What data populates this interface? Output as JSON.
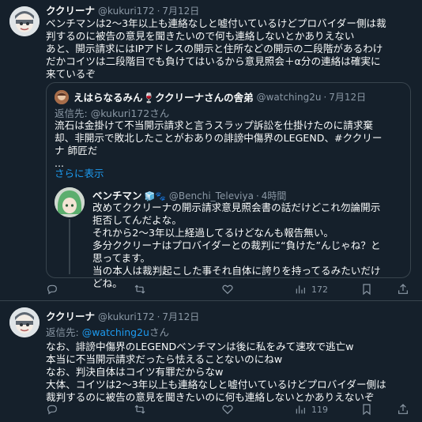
{
  "tweet1": {
    "name": "ククリーナ",
    "handle": "@kukuri172",
    "dot": "·",
    "time": "7月12日",
    "lines": [
      "ベンチマンは2～3年以上も連絡なしと嘘付いているけどプロバイダー側は裁",
      "判するのに被告の意見を聞きたいので何も連絡しないとかありえない",
      "あと、開示請求にはIPアドレスの開示と住所などの開示の二段階があるわけ",
      "だかコイツは二段階目でも負けてはいるから意見照会＋α分の連絡は確実に",
      "来ているぞ"
    ],
    "quote": {
      "name": "えはらなるみん🍷ククリーナさんの舎弟",
      "handle": "@watching2u",
      "dot": "·",
      "time": "7月12日",
      "reply_prefix": "返信先: ",
      "reply_handle": "@kukuri172",
      "reply_suffix": "さん",
      "lines": [
        "流石は金掛けて不当開示請求と言うスラップ訴訟を仕掛けたのに請求棄",
        "却、非開示で敗北したことがおありの誹謗中傷界のLEGEND、#ククリー",
        "ナ 師匠だ",
        "..."
      ],
      "show_more": "さらに表示"
    },
    "reply": {
      "name": "ベンチマン",
      "badges": "🧊🐾",
      "handle": "@Benchi_Televiya",
      "dot": "·",
      "time": "4時間",
      "lines": [
        "改めてククリーナの開示請求意見照会書の話だけどこれ勿論開示",
        "拒否してんだよな。",
        "それから2～3年以上経過してるけどなんも報告無い。",
        "多分ククリーナはプロバイダーとの裁判に“負けた”んじゃね？と",
        "思ってます。",
        "当の本人は裁判起こした事それ自体に誇りを持ってるみたいだけ",
        "どね。"
      ]
    },
    "actions": {
      "views": "172"
    }
  },
  "tweet2": {
    "name": "ククリーナ",
    "handle": "@kukuri172",
    "dot": "·",
    "time": "7月12日",
    "reply_prefix": "返信先: ",
    "reply_handle": "@watching2u",
    "reply_suffix": "さん",
    "lines": [
      "なお、誹謗中傷界のLEGENDベンチマンは後に私をみて速攻で逃亡w",
      "本当に不当開示請求だったら怯えることないのにねw",
      "なお、判決自体はコイツ有罪だからなw",
      "大体、コイツは2～3年以上も連絡なしと嘘付いているけどプロバイダー側は",
      "裁判するのに被告の意見を聞きたいのに何も連絡しないとかありえないぞ"
    ],
    "actions": {
      "views": "119"
    }
  },
  "colors": {
    "background": "#15202b",
    "text": "#f7f9f9",
    "muted": "#8b98a5",
    "link": "#1d9bf0",
    "border": "#38444d"
  }
}
